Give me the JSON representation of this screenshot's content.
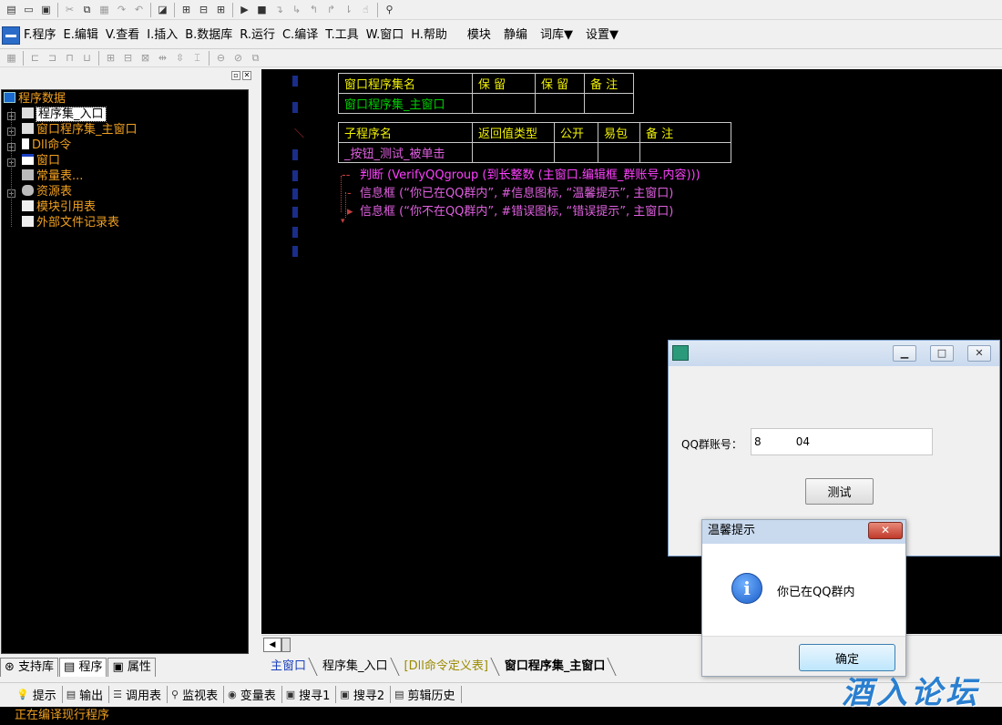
{
  "menu": {
    "items": [
      {
        "label": "F.程序"
      },
      {
        "label": "E.编辑"
      },
      {
        "label": "V.查看"
      },
      {
        "label": "I.插入"
      },
      {
        "label": "B.数据库"
      },
      {
        "label": "R.运行"
      },
      {
        "label": "C.编译"
      },
      {
        "label": "T.工具"
      },
      {
        "label": "W.窗口"
      },
      {
        "label": "H.帮助"
      },
      {
        "label": "模块"
      },
      {
        "label": "静编"
      },
      {
        "label": "词库▼"
      },
      {
        "label": "设置▼"
      }
    ]
  },
  "tree": {
    "root": "程序数据",
    "items": [
      {
        "label": "程序集_入口"
      },
      {
        "label": "窗口程序集_主窗口"
      },
      {
        "label": "Dll命令"
      },
      {
        "label": "窗口"
      },
      {
        "label": "常量表..."
      },
      {
        "label": "资源表"
      },
      {
        "label": "模块引用表"
      },
      {
        "label": "外部文件记录表"
      }
    ]
  },
  "left_tabs": [
    "支持库",
    "程序",
    "属性"
  ],
  "editor": {
    "assembly_table": {
      "headers": [
        "窗口程序集名",
        "保 留",
        "保 留",
        "备 注"
      ],
      "row": [
        "窗口程序集_主窗口",
        "",
        "",
        ""
      ]
    },
    "sub_table": {
      "headers": [
        "子程序名",
        "返回值类型",
        "公开",
        "易包",
        "备 注"
      ],
      "row": [
        "_按钮_测试_被单击",
        "",
        "",
        "",
        ""
      ]
    },
    "code_lines": [
      "判断 (VerifyQQgroup (到长整数 (主窗口.编辑框_群账号.内容)))",
      "信息框 (“你已在QQ群内”, #信息图标, “温馨提示”, 主窗口)",
      "信息框 (“你不在QQ群内”, #错误图标, “错误提示”, 主窗口)"
    ]
  },
  "editor_tabs": [
    "主窗口",
    "程序集_入口",
    "[Dll命令定义表]",
    "窗口程序集_主窗口"
  ],
  "bottom_tabs": [
    "提示",
    "输出",
    "调用表",
    "监视表",
    "变量表",
    "搜寻1",
    "搜寻2",
    "剪辑历史"
  ],
  "status": {
    "output": "正在编译现行程序"
  },
  "app_window": {
    "qq_label": "QQ群账号：",
    "qq_value": "8          04",
    "test_button": "测试"
  },
  "msgbox": {
    "title": "温馨提示",
    "message": "你已在QQ群内",
    "ok": "确定",
    "close": "✕"
  },
  "watermark": "酒入论坛",
  "colors": {
    "keyword_pink": "#ff40ff",
    "comment_green": "#00d000",
    "table_yellow": "#f0f000",
    "tree_orange": "#f0a020"
  }
}
